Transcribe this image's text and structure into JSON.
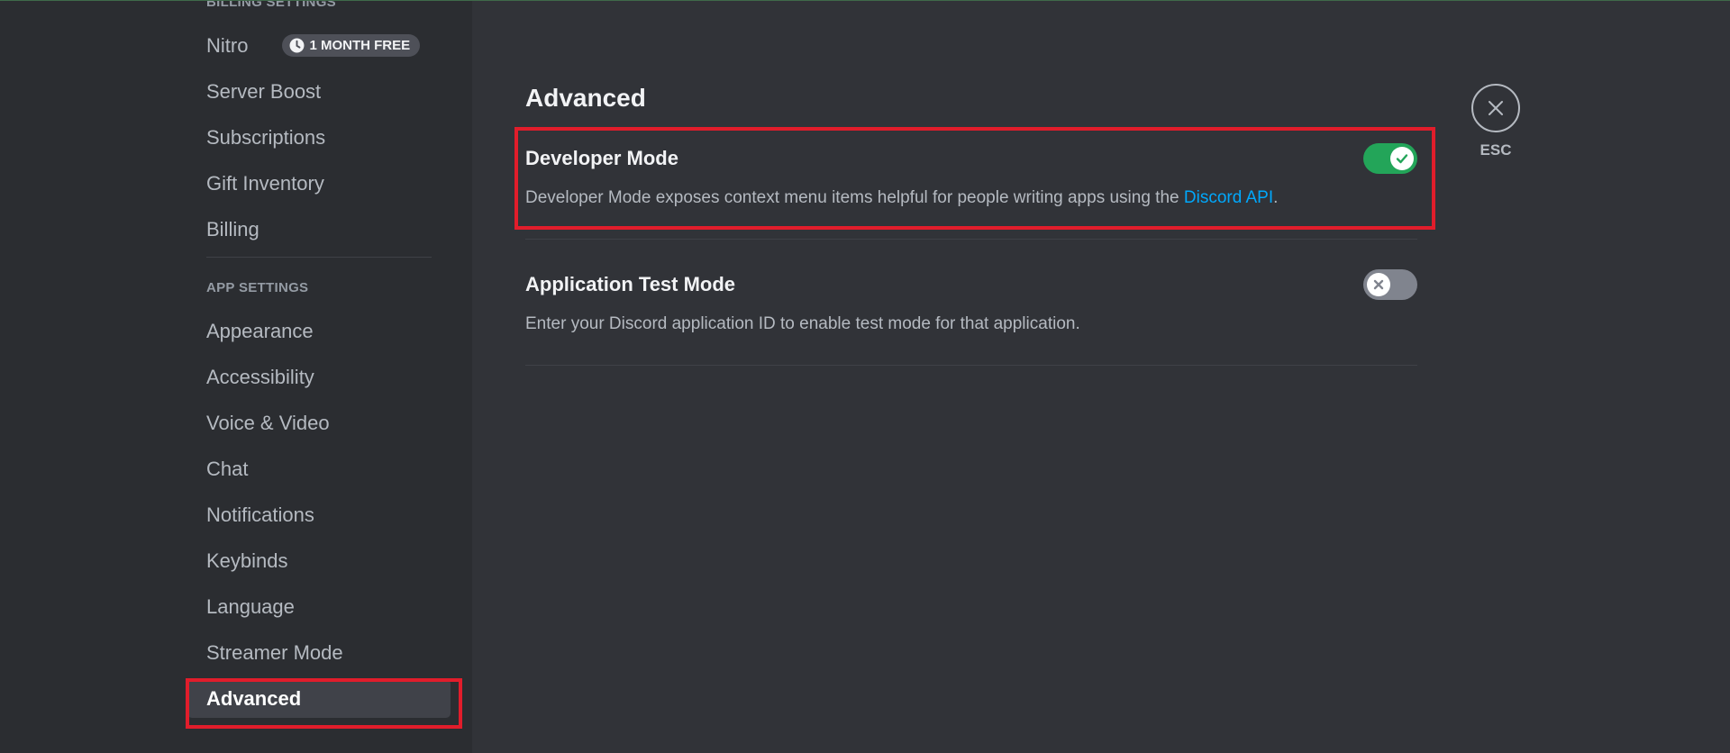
{
  "sidebar": {
    "billing_header": "Billing Settings",
    "billing_items": [
      {
        "label": "Nitro",
        "badge": "1 MONTH FREE"
      },
      {
        "label": "Server Boost"
      },
      {
        "label": "Subscriptions"
      },
      {
        "label": "Gift Inventory"
      },
      {
        "label": "Billing"
      }
    ],
    "app_header": "App Settings",
    "app_items": [
      {
        "label": "Appearance"
      },
      {
        "label": "Accessibility"
      },
      {
        "label": "Voice & Video"
      },
      {
        "label": "Chat"
      },
      {
        "label": "Notifications"
      },
      {
        "label": "Keybinds"
      },
      {
        "label": "Language"
      },
      {
        "label": "Streamer Mode"
      },
      {
        "label": "Advanced",
        "selected": true
      }
    ]
  },
  "main": {
    "title": "Advanced",
    "settings": [
      {
        "title": "Developer Mode",
        "description": "Developer Mode exposes context menu items helpful for people writing apps using the ",
        "link_text": "Discord API",
        "description_end": ".",
        "enabled": true
      },
      {
        "title": "Application Test Mode",
        "description": "Enter your Discord application ID to enable test mode for that application.",
        "enabled": false
      }
    ],
    "close_label": "ESC"
  },
  "colors": {
    "background": "#313338",
    "sidebar": "#2b2d31",
    "toggle_on": "#23a559",
    "toggle_off": "#80848e",
    "link": "#00a8fc",
    "highlight": "#e11d2b"
  },
  "icons": {
    "badge": "clock-icon",
    "toggle_on": "check-icon",
    "toggle_off": "x-icon",
    "close": "close-icon"
  }
}
